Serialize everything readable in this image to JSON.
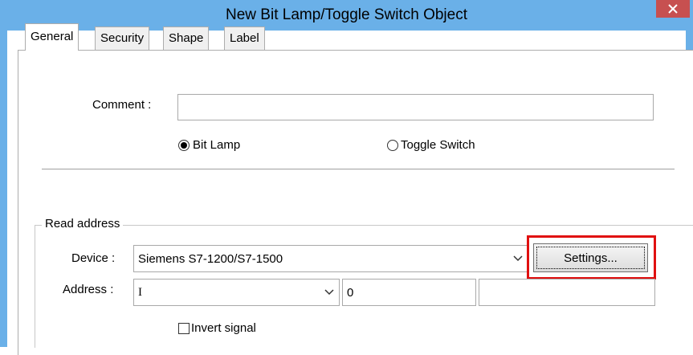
{
  "window": {
    "title": "New Bit Lamp/Toggle Switch Object",
    "close_glyph": "×"
  },
  "tabs": [
    {
      "label": "General",
      "active": true
    },
    {
      "label": "Security",
      "active": false
    },
    {
      "label": "Shape",
      "active": false
    },
    {
      "label": "Label",
      "active": false
    }
  ],
  "general": {
    "comment_label": "Comment :",
    "comment_value": "",
    "mode_options": [
      {
        "label": "Bit Lamp",
        "selected": true
      },
      {
        "label": "Toggle Switch",
        "selected": false
      }
    ]
  },
  "read_address": {
    "group_title": "Read address",
    "device_label": "Device :",
    "device_value": "Siemens S7-1200/S7-1500",
    "settings_button": "Settings...",
    "address_label": "Address :",
    "address_type_value": "I",
    "address_value": "0",
    "address_extra_value": "",
    "invert_signal_label": "Invert signal",
    "invert_signal_checked": false
  },
  "colors": {
    "titlebar": "#6ab0e8",
    "close_button": "#c75050",
    "highlight": "#e01010"
  }
}
